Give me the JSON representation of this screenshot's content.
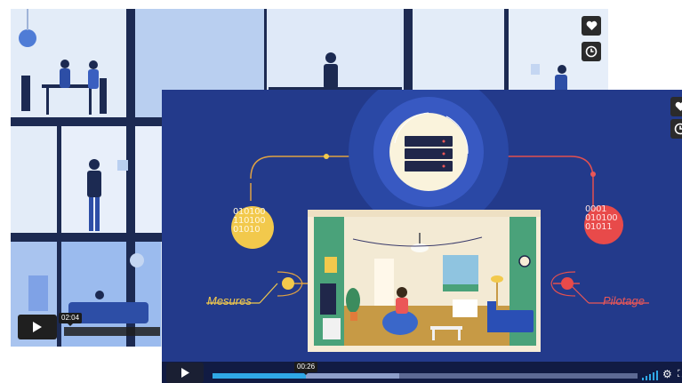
{
  "back_player": {
    "time_tooltip": "02:04",
    "like_icon": "heart-icon",
    "watch_later_icon": "clock-icon"
  },
  "front_player": {
    "time_tooltip": "00:26",
    "label_left": "Mesures",
    "label_right": "Pilotage",
    "binary_left": "010100\n110100\n01010",
    "binary_right": "0001\n010100\n01011",
    "like_icon": "heart-icon",
    "watch_later_icon": "clock-icon",
    "progress_played_fraction": 0.22,
    "progress_buffered_fraction": 0.44,
    "icons": [
      "play-icon",
      "volume-icon",
      "settings-icon",
      "fullscreen-icon"
    ]
  },
  "colors": {
    "front_bg": "#233a8b",
    "back_bg": "#cfe0f5",
    "progress_played": "#2fa8e6",
    "mesures_yellow": "#f2c94c",
    "pilotage_red": "#eb5757"
  }
}
